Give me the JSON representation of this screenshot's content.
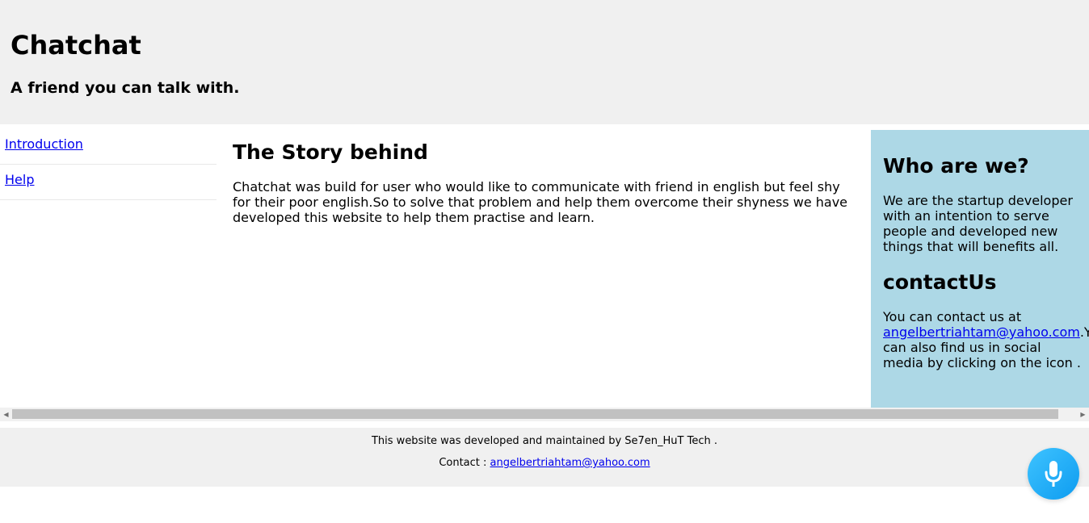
{
  "header": {
    "title": "Chatchat",
    "tagline": "A friend you can talk with."
  },
  "nav": {
    "items": [
      {
        "label": "Introduction"
      },
      {
        "label": "Help"
      }
    ]
  },
  "main": {
    "heading": "The Story behind",
    "body": "Chatchat was build for user who would like to communicate with friend in english but feel shy for their poor english.So to solve that problem and help them overcome their shyness we have developed this website to help them practise and learn."
  },
  "aside": {
    "who_heading": "Who are we?",
    "who_body": "We are the startup developer with an intention to serve people and developed new things that will benefits all.",
    "contact_heading": "contactUs",
    "contact_prefix": "You can contact us at ",
    "contact_email": "angelbertriahtam@yahoo.com",
    "contact_suffix": ".You can also find us in social media by clicking on the icon ."
  },
  "footer": {
    "developed_text": "This website was developed and maintained by Se7en_HuT Tech .",
    "contact_label": "Contact : ",
    "contact_email": "angelbertriahtam@yahoo.com"
  },
  "colors": {
    "header_bg": "#f0f0f0",
    "aside_bg": "#add8e6",
    "link": "#0000ee",
    "mic_button": "#1aa9f5"
  },
  "icons": {
    "mic": "microphone-icon",
    "scroll_left": "scroll-left-arrow-icon",
    "scroll_right": "scroll-right-arrow-icon"
  }
}
